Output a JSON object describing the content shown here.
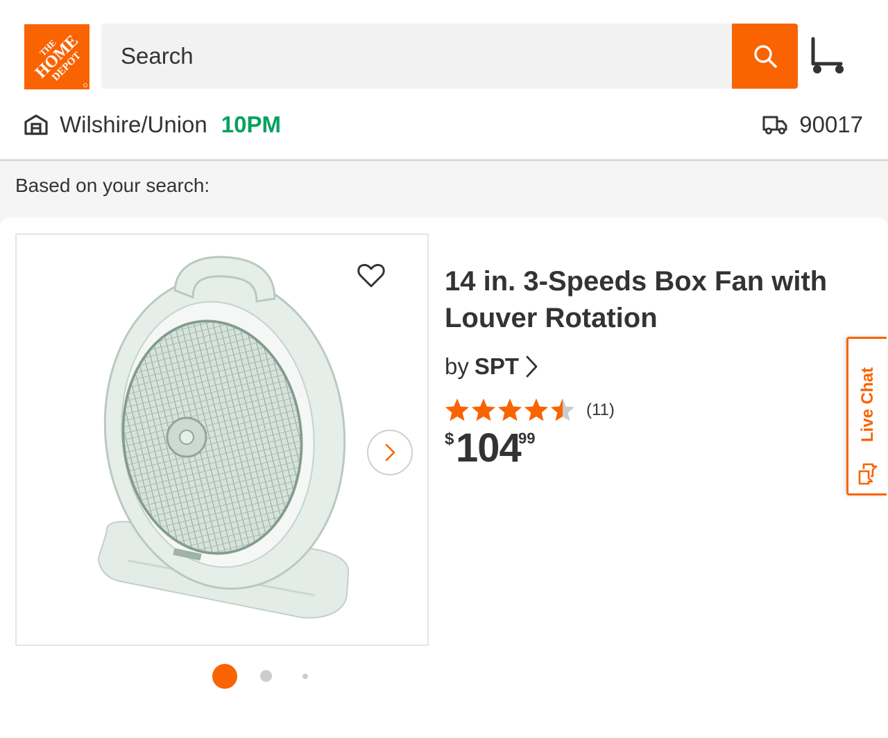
{
  "colors": {
    "brand_orange": "#f96302",
    "open_green": "#00a15f",
    "text": "#333333",
    "page_gray": "#f5f5f5"
  },
  "header": {
    "logo_text": [
      "THE",
      "HOME",
      "DEPOT"
    ],
    "search": {
      "placeholder": "Search",
      "icon": "search-icon"
    },
    "cart_icon": "cart-icon"
  },
  "store": {
    "icon": "store-icon",
    "name": "Wilshire/Union",
    "hours": "10PM"
  },
  "delivery": {
    "icon": "delivery-truck-icon",
    "zip": "90017"
  },
  "section": {
    "heading": "Based on your search:"
  },
  "product": {
    "title": "14 in. 3-Speeds Box Fan with Louver Rotation",
    "by_label": "by",
    "brand": "SPT",
    "rating": 4.5,
    "rating_max": 5,
    "review_count": "(11)",
    "price": {
      "currency": "$",
      "dollars": "104",
      "cents": "99"
    },
    "image_icon": "box-fan-image",
    "image_dots": {
      "count": 3,
      "active": 0
    }
  },
  "live_chat": {
    "label": "Live Chat",
    "icon": "chat-bubbles-icon"
  }
}
